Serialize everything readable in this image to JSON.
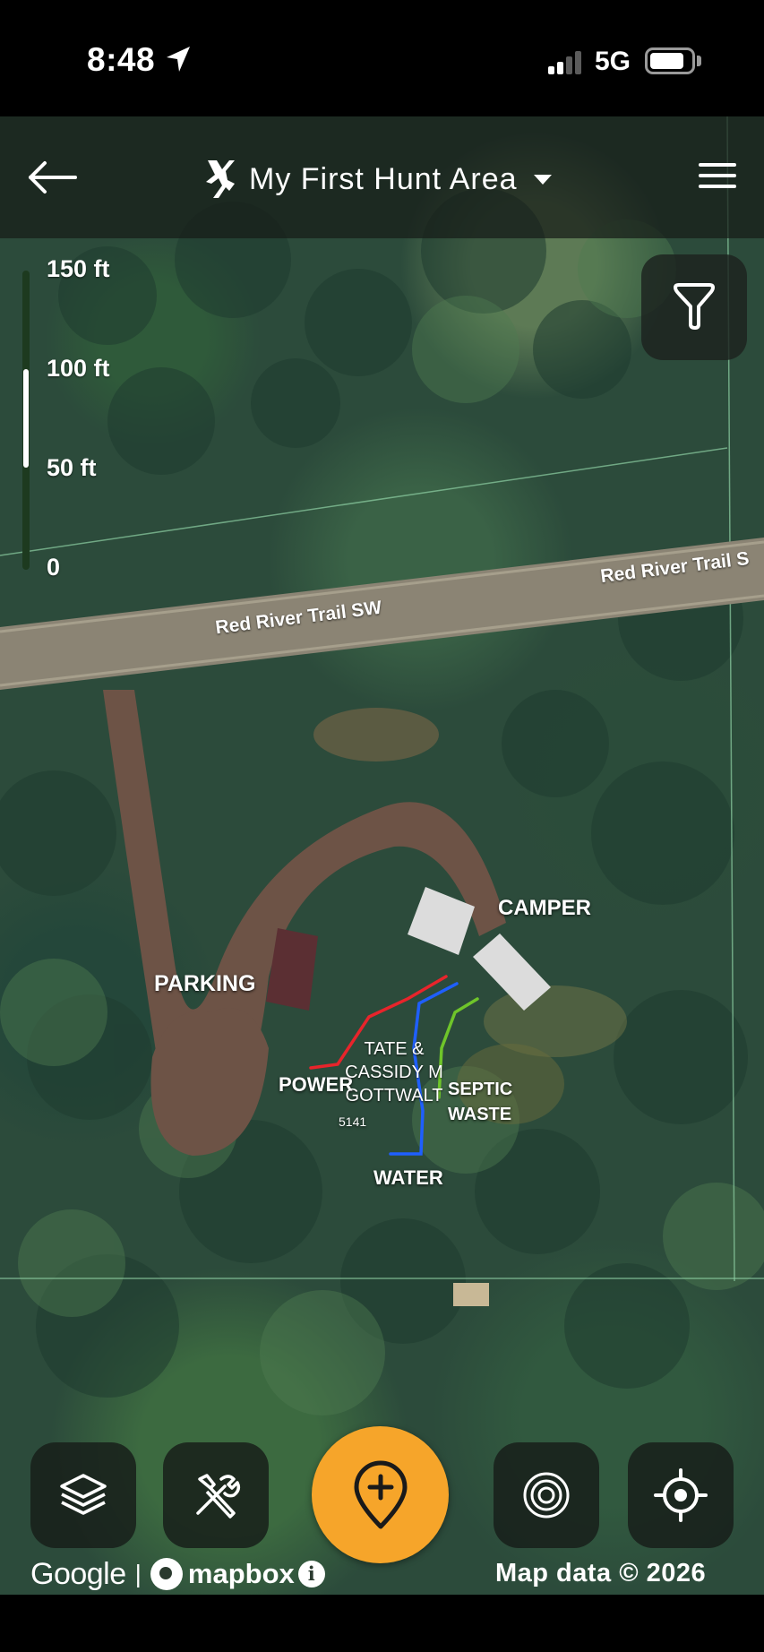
{
  "status_bar": {
    "time": "8:48",
    "network": "5G"
  },
  "header": {
    "title": "My First Hunt Area"
  },
  "scale_bar": {
    "labels": [
      "150 ft",
      "100 ft",
      "50 ft",
      "0"
    ]
  },
  "map": {
    "roads": [
      "Red River Trail SW",
      "Red River Trail S"
    ],
    "labels": {
      "camper": "CAMPER",
      "parking": "PARKING",
      "power": "POWER",
      "water": "WATER",
      "septic": "SEPTIC WASTE",
      "address": "5141",
      "owner": "TATE & CASSIDY M GOTTWALT"
    },
    "line_colors": {
      "power": "#e8242b",
      "water": "#1f5fff",
      "septic": "#6fc52a"
    }
  },
  "toolbar": {
    "buttons": [
      "layers-icon",
      "tools-icon",
      "add-marker-icon",
      "rings-icon",
      "locate-icon"
    ],
    "accent": "#f6a52a"
  },
  "attribution": {
    "google": "Google",
    "separator": "|",
    "mapbox": "mapbox",
    "info": "i",
    "map_data": "Map data © 2026"
  }
}
